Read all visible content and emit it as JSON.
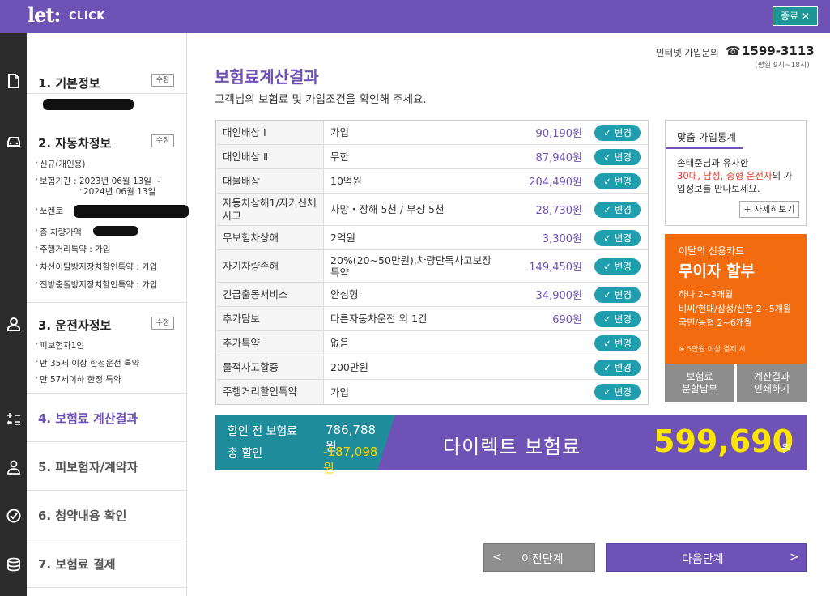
{
  "brand": {
    "logo": "let:",
    "logo_sub": "CLICK"
  },
  "close_label": "종료 ✕",
  "sidebar": {
    "basic": {
      "title": "1. 기본정보",
      "edit": "수정"
    },
    "car": {
      "title": "2. 자동차정보",
      "edit": "수정",
      "items": [
        "신규(개인용)",
        "보험기간 : 2023년 06월 13일 ~",
        "2024년 06월 13일",
        "쏘렌토",
        "총 차량가액",
        "주행거리특약 : 가입",
        "차선이탈방지장치할인특약 : 가입",
        "전방충돌방지장치할인특약 : 가입"
      ]
    },
    "driver": {
      "title": "3. 운전자정보",
      "edit": "수정",
      "items": [
        "피보험자1인",
        "만 35세 이상 한정운전 특약",
        "만 57세이하 한정 특약"
      ]
    },
    "steps": [
      "4. 보험료 계산결과",
      "5. 피보험자/계약자",
      "6. 청약내용 확인",
      "7. 보험료 결제"
    ]
  },
  "contact": {
    "label": "인터넷 가입문의",
    "phone": "1599-3113",
    "hours": "(평일 9시~18시)"
  },
  "main": {
    "title": "보험료계산결과",
    "subtitle": "고객님의 보험료 및 가입조건을 확인해 주세요."
  },
  "change_label": "변경",
  "coverage": [
    {
      "name": "대인배상 Ⅰ",
      "value": "가입",
      "premium": "90,190원"
    },
    {
      "name": "대인배상 Ⅱ",
      "value": "무한",
      "premium": "87,940원"
    },
    {
      "name": "대물배상",
      "value": "10억원",
      "premium": "204,490원"
    },
    {
      "name": "자동차상해1/자기신체사고",
      "value": "사망・장해 5천 / 부상 5천",
      "premium": "28,730원"
    },
    {
      "name": "무보험차상해",
      "value": "2억원",
      "premium": "3,300원"
    },
    {
      "name": "자기차량손해",
      "value": "20%(20~50만원),차량단독사고보장특약",
      "premium": "149,450원"
    },
    {
      "name": "긴급출동서비스",
      "value": "안심형",
      "premium": "34,900원"
    },
    {
      "name": "추가담보",
      "value": "다른자동차운전 외 1건",
      "premium": "690원"
    },
    {
      "name": "추가특약",
      "value": "없음",
      "premium": ""
    },
    {
      "name": "물적사고할증",
      "value": "200만원",
      "premium": ""
    },
    {
      "name": "주행거리할인특약",
      "value": "가입",
      "premium": ""
    }
  ],
  "stats": {
    "title": "맞춤 가입통계",
    "line1": "손태준님과 유사한",
    "line2_red": "30대, 남성, 중형 운전자",
    "line2_rest": "의 가",
    "line3": "입정보를 만나보세요.",
    "more": "+ 자세히보기"
  },
  "card": {
    "t1": "이달의 신용카드",
    "t2": "무이자 할부",
    "lines": [
      "하나 2~3개월",
      "비씨/현대/삼성/신한 2~5개월",
      "국민/농협 2~6개월"
    ],
    "note": "※ 5만원 이상 결제 시"
  },
  "buttons": {
    "installment": [
      "보험료",
      "분할납부"
    ],
    "print": [
      "계산결과",
      "인쇄하기"
    ],
    "prev": "이전단계",
    "next": "다음단계"
  },
  "summary": {
    "before_label": "할인 전 보험료",
    "before_amount": "786,788원",
    "discount_label": "총 할인",
    "discount_amount": "-187,098원",
    "direct_label": "다이렉트 보험료",
    "total": "599,690",
    "won": "원"
  }
}
